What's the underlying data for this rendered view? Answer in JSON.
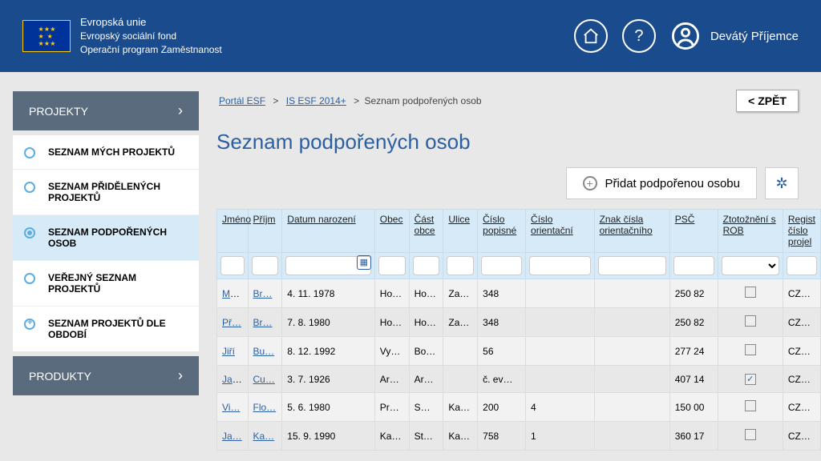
{
  "header": {
    "org1": "Evropská unie",
    "org2": "Evropský sociální fond",
    "org3": "Operační program Zaměstnanost",
    "user_name": "Devátý Příjemce"
  },
  "sidebar": {
    "sections": [
      {
        "label": "PROJEKTY",
        "expanded": true
      },
      {
        "label": "PRODUKTY",
        "expanded": false
      }
    ],
    "items": [
      {
        "label": "SEZNAM MÝCH PROJEKTŮ",
        "icon": "circle",
        "active": false
      },
      {
        "label": "SEZNAM PŘIDĚLENÝCH PROJEKTŮ",
        "icon": "circle",
        "active": false
      },
      {
        "label": "SEZNAM PODPOŘENÝCH OSOB",
        "icon": "dot",
        "active": true
      },
      {
        "label": "VEŘEJNÝ SEZNAM PROJEKTŮ",
        "icon": "circle",
        "active": false
      },
      {
        "label": "SEZNAM PROJEKTŮ DLE OBDOBÍ",
        "icon": "plus",
        "active": false
      }
    ]
  },
  "breadcrumbs": {
    "link1": "Portál ESF",
    "link2": "IS ESF 2014+",
    "current": "Seznam podpořených osob",
    "sep": ">"
  },
  "buttons": {
    "back": "< ZPĚT",
    "add_person": "Přidat podpořenou osobu"
  },
  "page_title": "Seznam podpořených osob",
  "table": {
    "headers": {
      "jmeno": "Jméno",
      "prijm": "Příjm",
      "datum": "Datum narození",
      "obec": "Obec",
      "cast": "Část obce",
      "ulice": "Ulice",
      "cpop": "Číslo popisné",
      "cori": "Číslo orientační",
      "znak": "Znak čísla orientačního",
      "psc": "PSČ",
      "ztot": "Ztotožnění s ROB",
      "reg": "Regist číslo projel"
    },
    "rows": [
      {
        "jmeno": "Ma…",
        "prijm": "Br…",
        "datum": "4. 11. 1978",
        "obec": "Ho…",
        "cast": "Ho…",
        "ulice": "Za…",
        "cpop": "348",
        "cori": "",
        "znak": "",
        "psc": "250 82",
        "ztot": false,
        "reg": "CZ…"
      },
      {
        "jmeno": "Př…",
        "prijm": "Br…",
        "datum": "7. 8. 1980",
        "obec": "Ho…",
        "cast": "Ho…",
        "ulice": "Za…",
        "cpop": "348",
        "cori": "",
        "znak": "",
        "psc": "250 82",
        "ztot": false,
        "reg": "CZ…"
      },
      {
        "jmeno": "Jiří",
        "prijm": "Bu…",
        "datum": "8. 12. 1992",
        "obec": "Vy…",
        "cast": "Bo…",
        "ulice": "",
        "cpop": "56",
        "cori": "",
        "znak": "",
        "psc": "277 24",
        "ztot": false,
        "reg": "CZ…"
      },
      {
        "jmeno": "Jana",
        "prijm": "Cu…",
        "datum": "3. 7. 1926",
        "obec": "Ar…",
        "cast": "Ar…",
        "ulice": "",
        "cpop": "č. ev…",
        "cori": "",
        "znak": "",
        "psc": "407 14",
        "ztot": true,
        "reg": "CZ…"
      },
      {
        "jmeno": "Vi…",
        "prijm": "Flo…",
        "datum": "5. 6. 1980",
        "obec": "Pr…",
        "cast": "Sm…",
        "ulice": "Ka…",
        "cpop": "200",
        "cori": "4",
        "znak": "",
        "psc": "150 00",
        "ztot": false,
        "reg": "CZ…"
      },
      {
        "jmeno": "Ja…",
        "prijm": "Ka…",
        "datum": "15. 9. 1990",
        "obec": "Ka…",
        "cast": "St…",
        "ulice": "Ka…",
        "cpop": "758",
        "cori": "1",
        "znak": "",
        "psc": "360 17",
        "ztot": false,
        "reg": "CZ…"
      }
    ]
  }
}
